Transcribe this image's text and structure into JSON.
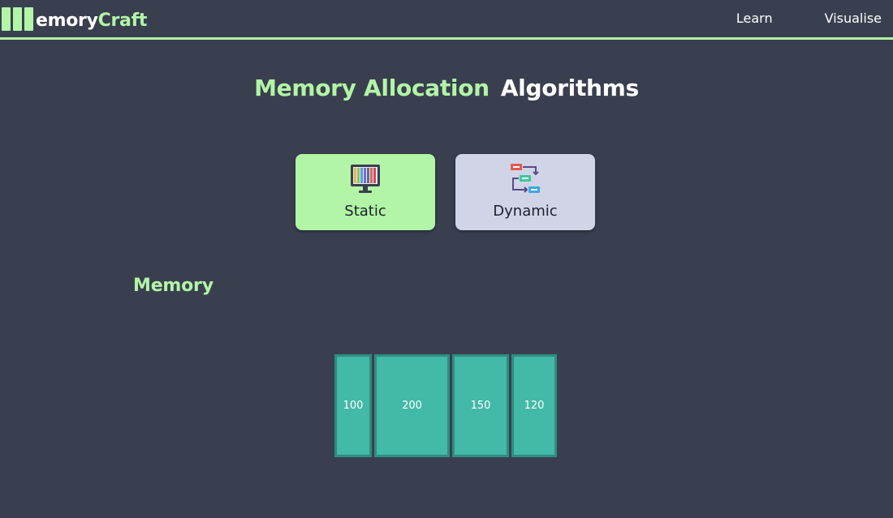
{
  "brand": {
    "text_white": "emory",
    "text_green": "Craft"
  },
  "nav": {
    "links": [
      {
        "label": "Learn"
      },
      {
        "label": "Visualise"
      }
    ]
  },
  "title": {
    "green": "Memory Allocation",
    "white": "Algorithms"
  },
  "modes": [
    {
      "label": "Static",
      "icon": "monitor-bars-icon",
      "active": true,
      "color": "#b2f5a6"
    },
    {
      "label": "Dynamic",
      "icon": "flow-diagram-icon",
      "active": false,
      "color": "#d0d4e6"
    }
  ],
  "memory": {
    "title": "Memory",
    "blocks": [
      {
        "size": 100
      },
      {
        "size": 200
      },
      {
        "size": 150
      },
      {
        "size": 120
      }
    ]
  },
  "colors": {
    "accent": "#b2f5a6",
    "background": "#3a3f50",
    "block_fill": "#43b9a7",
    "block_border": "#2e8d7f"
  }
}
